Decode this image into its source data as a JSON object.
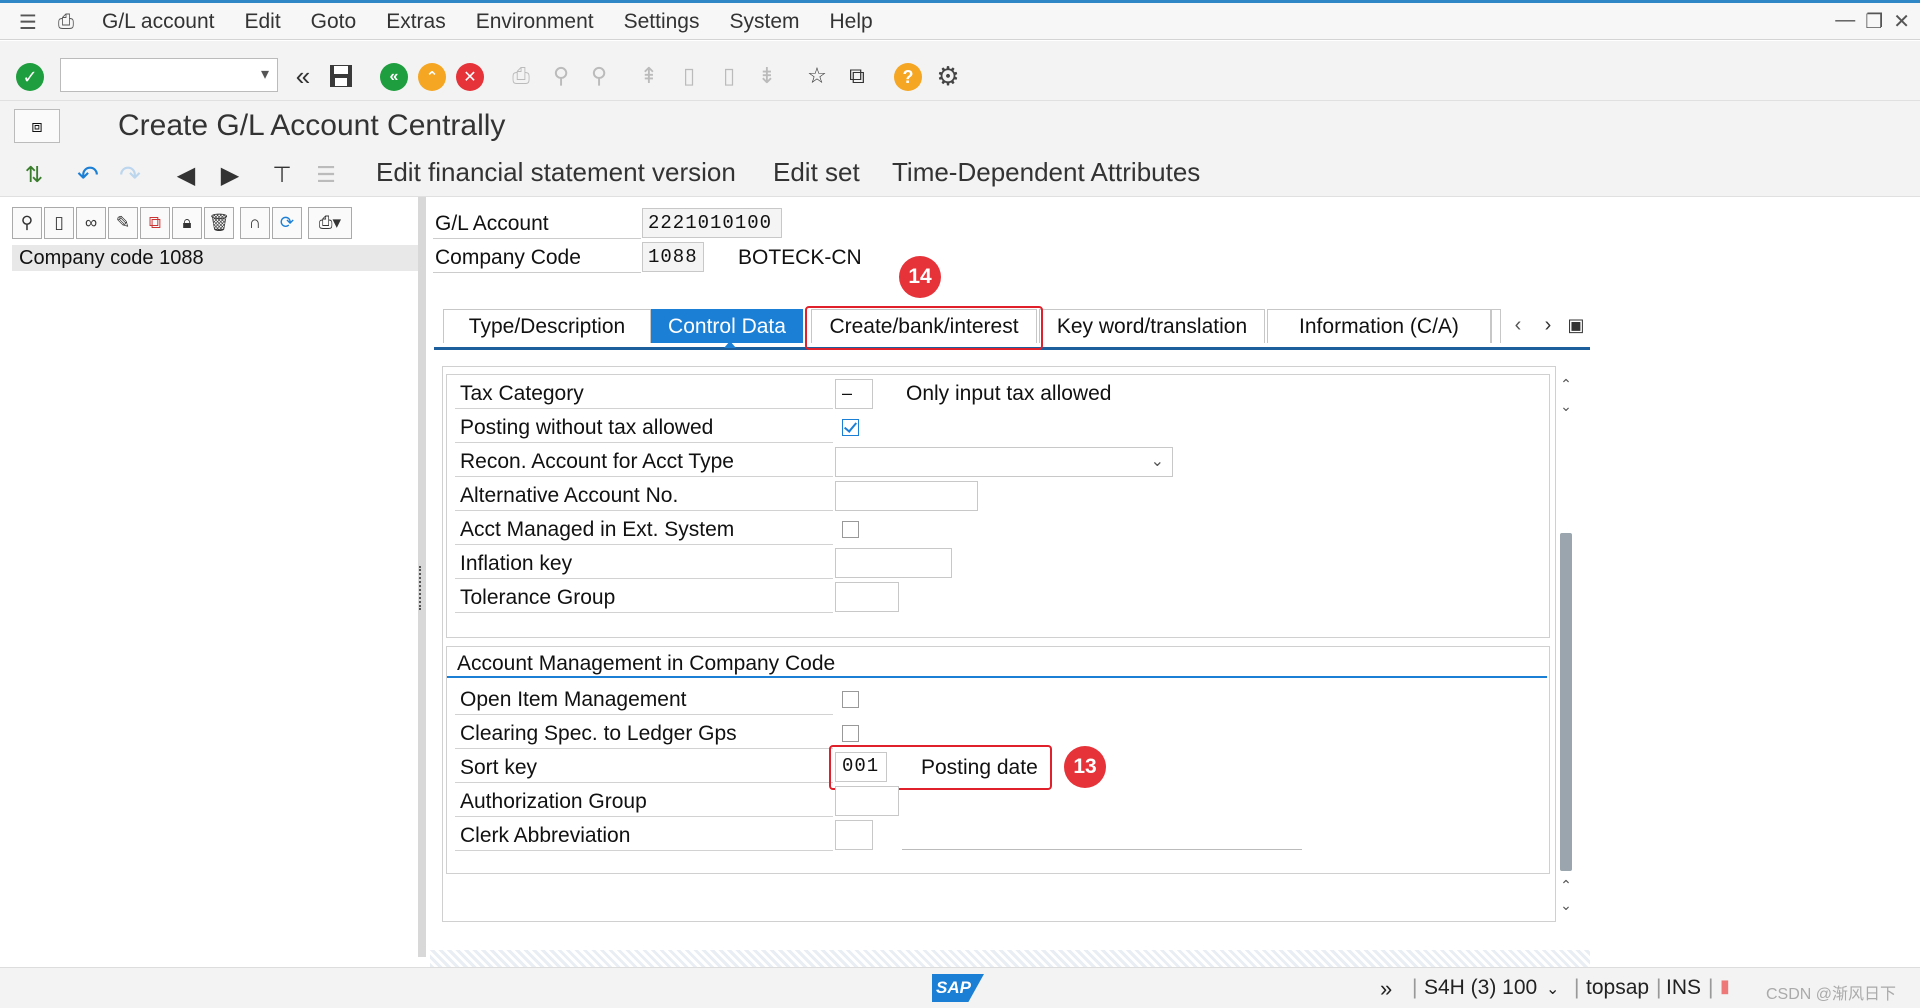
{
  "menu": {
    "items": [
      "G/L account",
      "Edit",
      "Goto",
      "Extras",
      "Environment",
      "Settings",
      "System",
      "Help"
    ]
  },
  "window": {
    "title": "Create G/L Account Centrally"
  },
  "toolbar2": {
    "buttons": [
      "Edit financial statement version",
      "Edit set",
      "Time-Dependent Attributes"
    ]
  },
  "left_pane": {
    "tree_item": "Company code 1088"
  },
  "header": {
    "gl_account_label": "G/L Account",
    "gl_account_value": "2221010100",
    "company_code_label": "Company Code",
    "company_code_value": "1088",
    "company_name": "BOTECK-CN"
  },
  "tabs": [
    {
      "label": "Type/Description",
      "active": false
    },
    {
      "label": "Control Data",
      "active": true
    },
    {
      "label": "Create/bank/interest",
      "active": false
    },
    {
      "label": "Key word/translation",
      "active": false
    },
    {
      "label": "Information (C/A)",
      "active": false
    }
  ],
  "control_data": {
    "tax_category_label": "Tax Category",
    "tax_category_value": "–",
    "tax_category_desc": "Only input tax allowed",
    "posting_wo_tax_label": "Posting without tax allowed",
    "posting_wo_tax_checked": true,
    "recon_account_label": "Recon. Account for Acct Type",
    "alt_account_label": "Alternative Account No.",
    "ext_system_label": "Acct Managed in Ext. System",
    "ext_system_checked": false,
    "inflation_key_label": "Inflation key",
    "tolerance_group_label": "Tolerance Group"
  },
  "account_mgmt": {
    "section_title": "Account Management in Company Code",
    "open_item_label": "Open Item Management",
    "open_item_checked": false,
    "clearing_spec_label": "Clearing Spec. to Ledger Gps",
    "clearing_spec_checked": false,
    "sort_key_label": "Sort key",
    "sort_key_value": "001",
    "sort_key_desc": "Posting date",
    "auth_group_label": "Authorization Group",
    "clerk_abbrev_label": "Clerk Abbreviation"
  },
  "annotations": {
    "badge_13": "13",
    "badge_14": "14"
  },
  "status_bar": {
    "system": "S4H (3) 100",
    "server": "topsap",
    "mode": "INS",
    "logo": "SAP",
    "watermark": "CSDN @渐风日下"
  },
  "colors": {
    "accent": "#1c7fd6",
    "highlight": "#e0202a",
    "green": "#1e9e3e",
    "orange": "#f5a623",
    "red": "#e53339"
  }
}
